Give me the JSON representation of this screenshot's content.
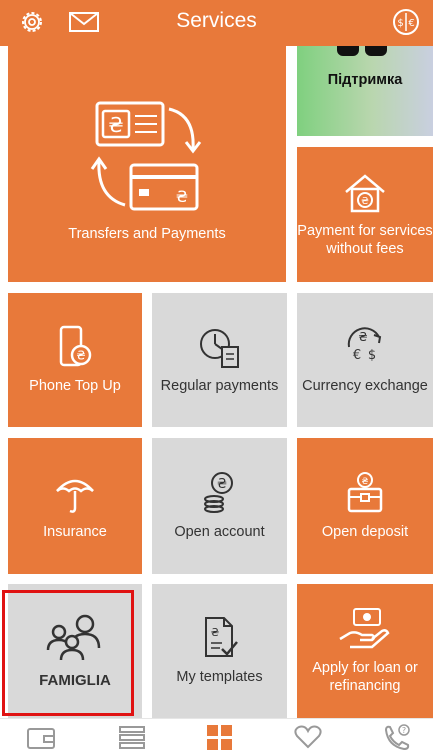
{
  "header": {
    "title": "Services",
    "icons": {
      "settings": "gear-icon",
      "messages": "envelope-icon",
      "currency": "currency-icon"
    }
  },
  "tiles": {
    "transfers": {
      "label": "Transfers and Payments",
      "icon": "transfer-card-icon"
    },
    "support": {
      "label": "Підтримка"
    },
    "payment_services": {
      "label": "Payment for services without fees",
      "icon": "house-hryvnia-icon"
    },
    "phone_top_up": {
      "label": "Phone Top Up",
      "icon": "phone-hryvnia-icon"
    },
    "regular_payments": {
      "label": "Regular payments",
      "icon": "clock-document-icon"
    },
    "currency_exchange": {
      "label": "Currency exchange",
      "icon": "currency-exchange-icon"
    },
    "insurance": {
      "label": "Insurance",
      "icon": "umbrella-icon"
    },
    "open_account": {
      "label": "Open account",
      "icon": "coins-icon"
    },
    "open_deposit": {
      "label": "Open deposit",
      "icon": "chest-icon"
    },
    "famiglia": {
      "label": "FAMIGLIA",
      "icon": "family-icon"
    },
    "my_templates": {
      "label": "My templates",
      "icon": "template-icon"
    },
    "loan": {
      "label": "Apply for loan or refinancing",
      "icon": "hand-money-icon"
    }
  },
  "bottom_nav": {
    "items": [
      "wallet-icon",
      "list-icon",
      "grid-icon",
      "heart-icon",
      "phone-question-icon"
    ],
    "active": "grid-icon"
  },
  "colors": {
    "accent": "#e8793a",
    "tile_grey": "#d9d9d9",
    "highlight": "#e01212"
  }
}
